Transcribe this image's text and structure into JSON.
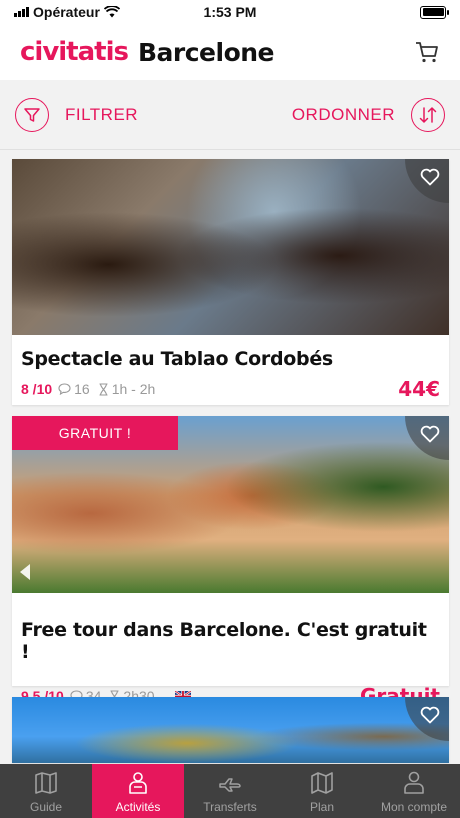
{
  "status": {
    "carrier": "Opérateur",
    "time": "1:53 PM"
  },
  "header": {
    "brand": "civitatis",
    "city": "Barcelone"
  },
  "filter_bar": {
    "filter_label": "FILTRER",
    "order_label": "ORDONNER"
  },
  "colors": {
    "accent": "#e6175c",
    "tabbar": "#404040"
  },
  "activities": [
    {
      "title": "Spectacle au Tablao Cordobés",
      "rating": "8 /10",
      "reviews": "16",
      "duration": "1h - 2h",
      "price": "44€",
      "badge": "",
      "flag": ""
    },
    {
      "title": "Free tour dans Barcelone. C'est gratuit !",
      "rating": "9.5 /10",
      "reviews": "34",
      "duration": "2h30",
      "price": "Gratuit",
      "badge": "GRATUIT !",
      "flag": "uk-flag"
    }
  ],
  "tabs": [
    {
      "label": "Guide",
      "icon": "map-book-icon",
      "active": false
    },
    {
      "label": "Activités",
      "icon": "person-icon",
      "active": true
    },
    {
      "label": "Transferts",
      "icon": "plane-icon",
      "active": false
    },
    {
      "label": "Plan",
      "icon": "map-icon",
      "active": false
    },
    {
      "label": "Mon compte",
      "icon": "account-icon",
      "active": false
    }
  ]
}
